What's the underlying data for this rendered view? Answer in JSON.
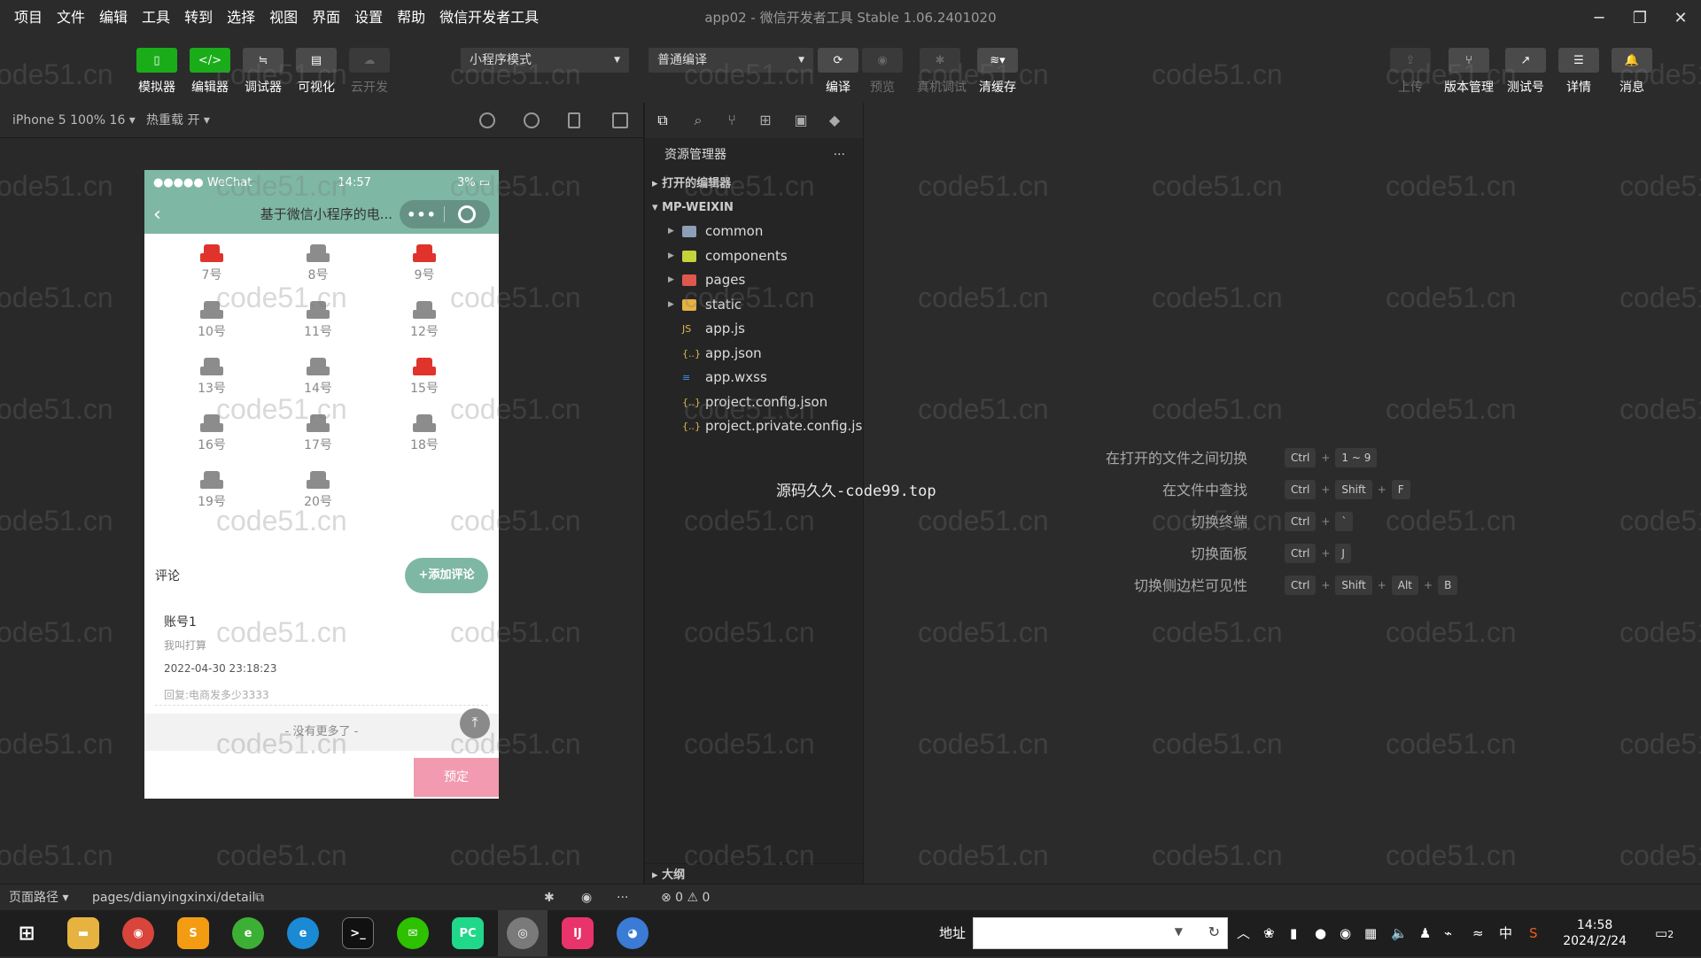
{
  "menu": [
    "项目",
    "文件",
    "编辑",
    "工具",
    "转到",
    "选择",
    "视图",
    "界面",
    "设置",
    "帮助",
    "微信开发者工具"
  ],
  "window_title": "app02 - 微信开发者工具 Stable 1.06.2401020",
  "toolbar": {
    "simulator": "模拟器",
    "editor": "编辑器",
    "debugger": "调试器",
    "visual": "可视化",
    "cloud": "云开发",
    "mode": "小程序模式",
    "compile_mode": "普通编译",
    "compile": "编译",
    "preview": "预览",
    "remote_debug": "真机调试",
    "clear_cache": "清缓存",
    "upload": "上传",
    "version": "版本管理",
    "test": "测试号",
    "details": "详情",
    "messages": "消息"
  },
  "subbar": {
    "device": "iPhone 5 100% 16 ▾",
    "hot_reload": "热重载 开 ▾"
  },
  "phone": {
    "carrier": "●●●●● WeChat",
    "time": "14:57",
    "battery": "3%",
    "nav_title": "基于微信小程序的电...",
    "seats": [
      {
        "label": "7号",
        "state": "red"
      },
      {
        "label": "8号",
        "state": "gray"
      },
      {
        "label": "9号",
        "state": "red"
      },
      {
        "label": "10号",
        "state": "gray"
      },
      {
        "label": "11号",
        "state": "gray"
      },
      {
        "label": "12号",
        "state": "gray"
      },
      {
        "label": "13号",
        "state": "gray"
      },
      {
        "label": "14号",
        "state": "gray"
      },
      {
        "label": "15号",
        "state": "red"
      },
      {
        "label": "16号",
        "state": "gray"
      },
      {
        "label": "17号",
        "state": "gray"
      },
      {
        "label": "18号",
        "state": "gray"
      },
      {
        "label": "19号",
        "state": "gray"
      },
      {
        "label": "20号",
        "state": "gray"
      }
    ],
    "comment_label": "评论",
    "add_comment": "+添加评论",
    "comment": {
      "name": "账号1",
      "text": "我叫打算",
      "time": "2022-04-30 23:18:23",
      "reply": "回复:电商发多少3333"
    },
    "no_more": "- 没有更多了 -",
    "book": "预定",
    "colors": {
      "accent": "#7fb7a5",
      "seat_taken": "#e0332b",
      "seat_free": "#8c8c8c",
      "book": "#f19ab0"
    }
  },
  "explorer": {
    "title": "资源管理器",
    "open_editors": "打开的编辑器",
    "project": "MP-WEIXIN",
    "items": [
      {
        "name": "common",
        "icon": "folder-icon",
        "folder": true
      },
      {
        "name": "components",
        "icon": "folder-components-icon",
        "folder": true
      },
      {
        "name": "pages",
        "icon": "folder-pages-icon",
        "folder": true
      },
      {
        "name": "static",
        "icon": "folder-static-icon",
        "folder": true
      },
      {
        "name": "app.js",
        "icon": "js-file-icon",
        "folder": false
      },
      {
        "name": "app.json",
        "icon": "json-file-icon",
        "folder": false
      },
      {
        "name": "app.wxss",
        "icon": "css-file-icon",
        "folder": false
      },
      {
        "name": "project.config.json",
        "icon": "json-file-icon",
        "folder": false
      },
      {
        "name": "project.private.config.js...",
        "icon": "json-file-icon",
        "folder": false
      }
    ],
    "outline": "大纲"
  },
  "shortcuts": [
    {
      "label": "在打开的文件之间切换",
      "keys": [
        "Ctrl",
        "1 ~ 9"
      ]
    },
    {
      "label": "在文件中查找",
      "keys": [
        "Ctrl",
        "Shift",
        "F"
      ]
    },
    {
      "label": "切换终端",
      "keys": [
        "Ctrl",
        "`"
      ]
    },
    {
      "label": "切换面板",
      "keys": [
        "Ctrl",
        "J"
      ]
    },
    {
      "label": "切换侧边栏可见性",
      "keys": [
        "Ctrl",
        "Shift",
        "Alt",
        "B"
      ]
    }
  ],
  "center_note": "源码久久-code99.top",
  "statusbar": {
    "page_path_label": "页面路径 ▾",
    "page_path": "pages/dianyingxinxi/detail",
    "errors": "⊗ 0 ⚠ 0"
  },
  "taskbar": {
    "address_label": "地址",
    "ime": "中",
    "time": "14:58",
    "date": "2024/2/24",
    "notifications": "2"
  },
  "watermark": "code51.cn"
}
